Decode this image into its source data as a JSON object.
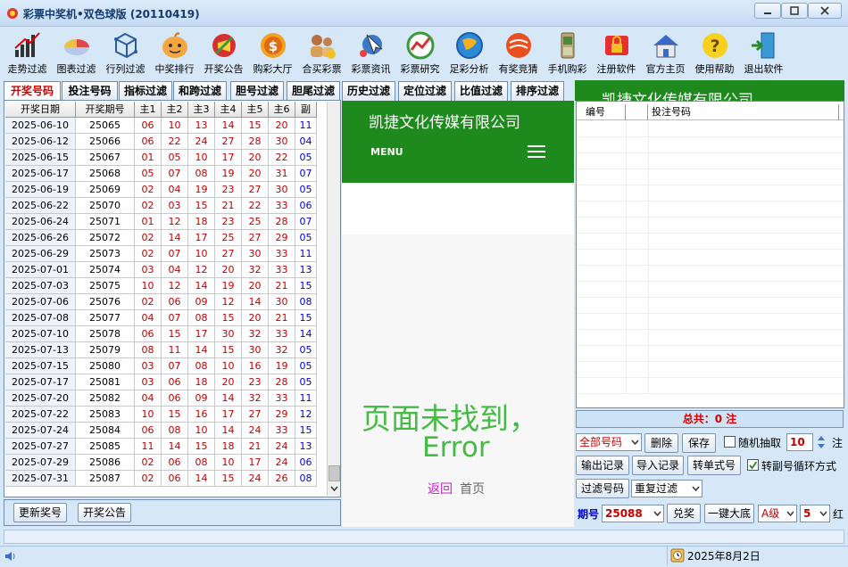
{
  "window": {
    "title": "彩票中奖机•双色球版 (20110419)"
  },
  "toolbar": [
    {
      "label": "走势过滤",
      "icon": "graph-chart-icon"
    },
    {
      "label": "图表过滤",
      "icon": "pie-chart-icon"
    },
    {
      "label": "行列过滤",
      "icon": "grid-cube-icon"
    },
    {
      "label": "中奖排行",
      "icon": "smiley-face-icon"
    },
    {
      "label": "开奖公告",
      "icon": "announcement-icon"
    },
    {
      "label": "购彩大厅",
      "icon": "coin-icon"
    },
    {
      "label": "合买彩票",
      "icon": "users-icon"
    },
    {
      "label": "彩票资讯",
      "icon": "cursor-news-icon"
    },
    {
      "label": "彩票研究",
      "icon": "research-chart-icon"
    },
    {
      "label": "足彩分析",
      "icon": "football-icon"
    },
    {
      "label": "有奖竞猜",
      "icon": "fire-ball-icon"
    },
    {
      "label": "手机购彩",
      "icon": "mobile-phone-icon"
    },
    {
      "label": "注册软件",
      "icon": "lock-icon"
    },
    {
      "label": "官方主页",
      "icon": "home-icon"
    },
    {
      "label": "使用帮助",
      "icon": "help-icon"
    },
    {
      "label": "退出软件",
      "icon": "exit-icon"
    }
  ],
  "tabs": [
    "开奖号码",
    "投注号码",
    "指标过滤",
    "和跨过滤",
    "胆号过滤",
    "胆尾过滤",
    "历史过滤",
    "定位过滤",
    "比值过滤",
    "排序过滤"
  ],
  "table": {
    "headers": [
      "开奖日期",
      "开奖期号",
      "主1",
      "主2",
      "主3",
      "主4",
      "主5",
      "主6",
      "副"
    ],
    "rows": [
      [
        "2025-06-10",
        "25065",
        "06",
        "10",
        "13",
        "14",
        "15",
        "20",
        "11"
      ],
      [
        "2025-06-12",
        "25066",
        "06",
        "22",
        "24",
        "27",
        "28",
        "30",
        "04"
      ],
      [
        "2025-06-15",
        "25067",
        "01",
        "05",
        "10",
        "17",
        "20",
        "22",
        "05"
      ],
      [
        "2025-06-17",
        "25068",
        "05",
        "07",
        "08",
        "19",
        "20",
        "31",
        "07"
      ],
      [
        "2025-06-19",
        "25069",
        "02",
        "04",
        "19",
        "23",
        "27",
        "30",
        "05"
      ],
      [
        "2025-06-22",
        "25070",
        "02",
        "03",
        "15",
        "21",
        "22",
        "33",
        "06"
      ],
      [
        "2025-06-24",
        "25071",
        "01",
        "12",
        "18",
        "23",
        "25",
        "28",
        "07"
      ],
      [
        "2025-06-26",
        "25072",
        "02",
        "14",
        "17",
        "25",
        "27",
        "29",
        "05"
      ],
      [
        "2025-06-29",
        "25073",
        "02",
        "07",
        "10",
        "27",
        "30",
        "33",
        "11"
      ],
      [
        "2025-07-01",
        "25074",
        "03",
        "04",
        "12",
        "20",
        "32",
        "33",
        "13"
      ],
      [
        "2025-07-03",
        "25075",
        "10",
        "12",
        "14",
        "19",
        "20",
        "21",
        "15"
      ],
      [
        "2025-07-06",
        "25076",
        "02",
        "06",
        "09",
        "12",
        "14",
        "30",
        "08"
      ],
      [
        "2025-07-08",
        "25077",
        "04",
        "07",
        "08",
        "15",
        "20",
        "21",
        "15"
      ],
      [
        "2025-07-10",
        "25078",
        "06",
        "15",
        "17",
        "30",
        "32",
        "33",
        "14"
      ],
      [
        "2025-07-13",
        "25079",
        "08",
        "11",
        "14",
        "15",
        "30",
        "32",
        "05"
      ],
      [
        "2025-07-15",
        "25080",
        "03",
        "07",
        "08",
        "10",
        "16",
        "19",
        "05"
      ],
      [
        "2025-07-17",
        "25081",
        "03",
        "06",
        "18",
        "20",
        "23",
        "28",
        "05"
      ],
      [
        "2025-07-20",
        "25082",
        "04",
        "06",
        "09",
        "14",
        "32",
        "33",
        "11"
      ],
      [
        "2025-07-22",
        "25083",
        "10",
        "15",
        "16",
        "17",
        "27",
        "29",
        "12"
      ],
      [
        "2025-07-24",
        "25084",
        "06",
        "08",
        "10",
        "14",
        "24",
        "33",
        "15"
      ],
      [
        "2025-07-27",
        "25085",
        "11",
        "14",
        "15",
        "18",
        "21",
        "24",
        "13"
      ],
      [
        "2025-07-29",
        "25086",
        "02",
        "06",
        "08",
        "10",
        "17",
        "24",
        "06"
      ],
      [
        "2025-07-31",
        "25087",
        "02",
        "06",
        "14",
        "15",
        "24",
        "26",
        "08"
      ]
    ]
  },
  "left_buttons": {
    "update": "更新奖号",
    "announce": "开奖公告"
  },
  "web": {
    "company": "凯捷文化传媒有限公司",
    "menu": "MENU",
    "error_line1": "页面未找到，",
    "error_line2": "Error",
    "back": "返回",
    "home": "首页"
  },
  "right": {
    "header_text": "凯捷文化传媒有限公司",
    "list_headers": [
      "编号",
      "投注号码"
    ],
    "total_label": "总共：0 注",
    "filter_select": "全部号码",
    "delete": "删除",
    "save": "保存",
    "random_label": "随机抽取",
    "random_count": "10",
    "random_unit": "注",
    "export": "输出记录",
    "import": "导入记录",
    "convert": "转单式号",
    "cycle_label": "转副号循环方式",
    "filter_btn": "过滤号码",
    "repeat_select": "重复过滤",
    "issue_label": "期号",
    "issue_value": "25088",
    "prize_btn": "兑奖",
    "bottom_btn": "一键大底",
    "level_select": "A级",
    "count_select": "5",
    "red_label": "红"
  },
  "status": {
    "date": "2025年8月2日"
  },
  "colors": {
    "red_ball": "#c00000",
    "blue_ball": "#0000cc",
    "web_green": "#1e8a1e",
    "error_green": "#44bb44"
  }
}
